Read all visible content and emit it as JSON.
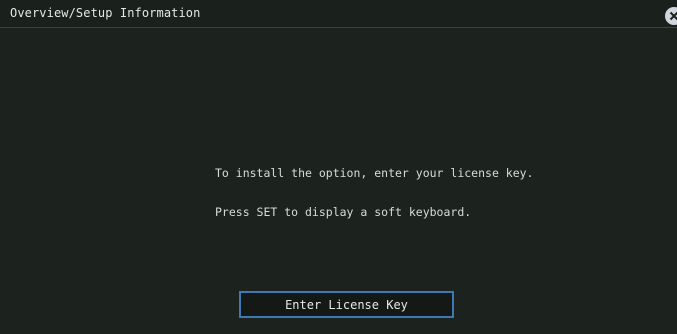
{
  "window": {
    "title": "Overview/Setup Information",
    "close_icon": "close-icon"
  },
  "message": {
    "line1": "To install the option, enter your license key.",
    "line2": "Press SET to display a soft keyboard."
  },
  "actions": {
    "enter_license_key_label": "Enter License Key"
  },
  "colors": {
    "background": "#1c221d",
    "button_border": "#3f78b6",
    "text": "#d6dcd6"
  }
}
